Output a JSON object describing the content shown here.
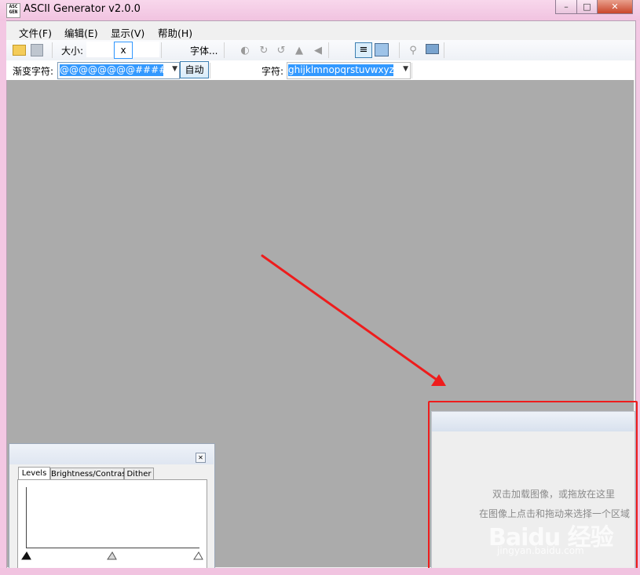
{
  "window": {
    "title": "ASCII Generator v2.0.0",
    "icon_text": "ASC GEN",
    "minimize": "–",
    "maximize": "□",
    "close": "✕"
  },
  "menu": {
    "items": [
      "文件(F)",
      "编辑(E)",
      "显示(V)",
      "帮助(H)"
    ]
  },
  "toolbar": {
    "size_label": "大小:",
    "size_separator": "x",
    "font_button": "字体...",
    "icons": [
      "open-folder-icon",
      "save-icon",
      "invert-icon",
      "rotate-cw-icon",
      "rotate-ccw-icon",
      "flip-vertical-icon",
      "flip-horizontal-icon",
      "text-view-icon",
      "image-view-icon",
      "preview-icon",
      "monitor-icon"
    ]
  },
  "toolbar2": {
    "ramp_label": "渐变字符:",
    "ramp_value": "@@@@@@@@####%%%%*****++++;;;;:::::,,,,,,.......",
    "auto_button": "自动",
    "chars_label": "字符:",
    "chars_value": "ghijklmnopqrstuvwxyz$"
  },
  "levels_panel": {
    "close": "✕",
    "tabs": [
      "Levels",
      "Brightness/Contrast",
      "Dither"
    ],
    "active_tab": "Levels"
  },
  "preview_panel": {
    "hint_line1": "双击加载图像，或拖放在这里",
    "hint_line2": "在图像上点击和拖动来选择一个区域"
  },
  "annotation": {
    "arrow_color": "#ee1c1c",
    "box_color": "#ee1c1c"
  },
  "watermark": {
    "brand": "Baidu 经验",
    "url": "jingyan.baidu.com"
  }
}
